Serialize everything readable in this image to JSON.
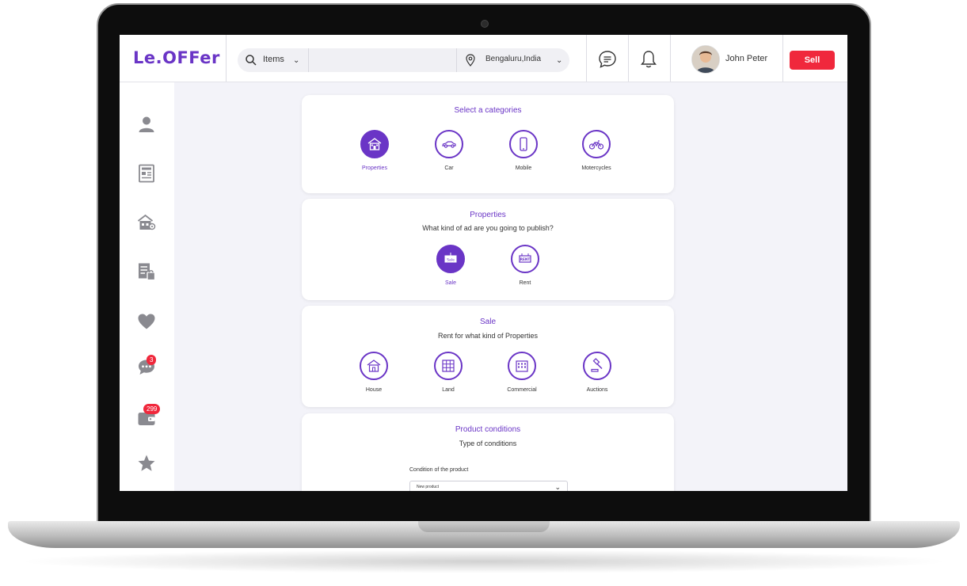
{
  "brand": {
    "logo_text": "Le.OFFer",
    "accent": "#6a35c6",
    "alert": "#f0283c"
  },
  "header": {
    "search_category": "Items",
    "search_placeholder": "",
    "location": "Bengaluru,India",
    "user_name": "John Peter",
    "sell_label": "Sell"
  },
  "sidebar": {
    "items": [
      {
        "icon": "user-icon"
      },
      {
        "icon": "newspaper-icon"
      },
      {
        "icon": "property-location-icon"
      },
      {
        "icon": "listing-bag-icon"
      },
      {
        "icon": "heart-icon"
      },
      {
        "icon": "chat-icon",
        "badge": "3"
      },
      {
        "icon": "wallet-icon",
        "badge": "299"
      },
      {
        "icon": "star-icon"
      }
    ]
  },
  "categories": {
    "title": "Select a categories",
    "options": [
      {
        "label": "Properties",
        "icon": "house-icon",
        "selected": true
      },
      {
        "label": "Car",
        "icon": "car-icon",
        "selected": false
      },
      {
        "label": "Mobile",
        "icon": "mobile-icon",
        "selected": false
      },
      {
        "label": "Motercycles",
        "icon": "motorcycle-icon",
        "selected": false
      }
    ]
  },
  "ad_type": {
    "title": "Properties",
    "subtitle": "What kind of ad are you going to publish?",
    "options": [
      {
        "label": "Sale",
        "icon": "sale-sign-icon",
        "sign_text": "Sale",
        "selected": true
      },
      {
        "label": "Rent",
        "icon": "rent-sign-icon",
        "sign_text": "RENT",
        "selected": false
      }
    ]
  },
  "property_kind": {
    "title": "Sale",
    "subtitle": "Rent for what kind of Properties",
    "options": [
      {
        "label": "House",
        "icon": "house-icon"
      },
      {
        "label": "Land",
        "icon": "land-icon"
      },
      {
        "label": "Commercial",
        "icon": "building-icon"
      },
      {
        "label": "Auctions",
        "icon": "gavel-icon"
      }
    ]
  },
  "conditions": {
    "title": "Product conditions",
    "subtitle": "Type of conditions",
    "field_label": "Condition of the product",
    "selected_value": "New product"
  }
}
